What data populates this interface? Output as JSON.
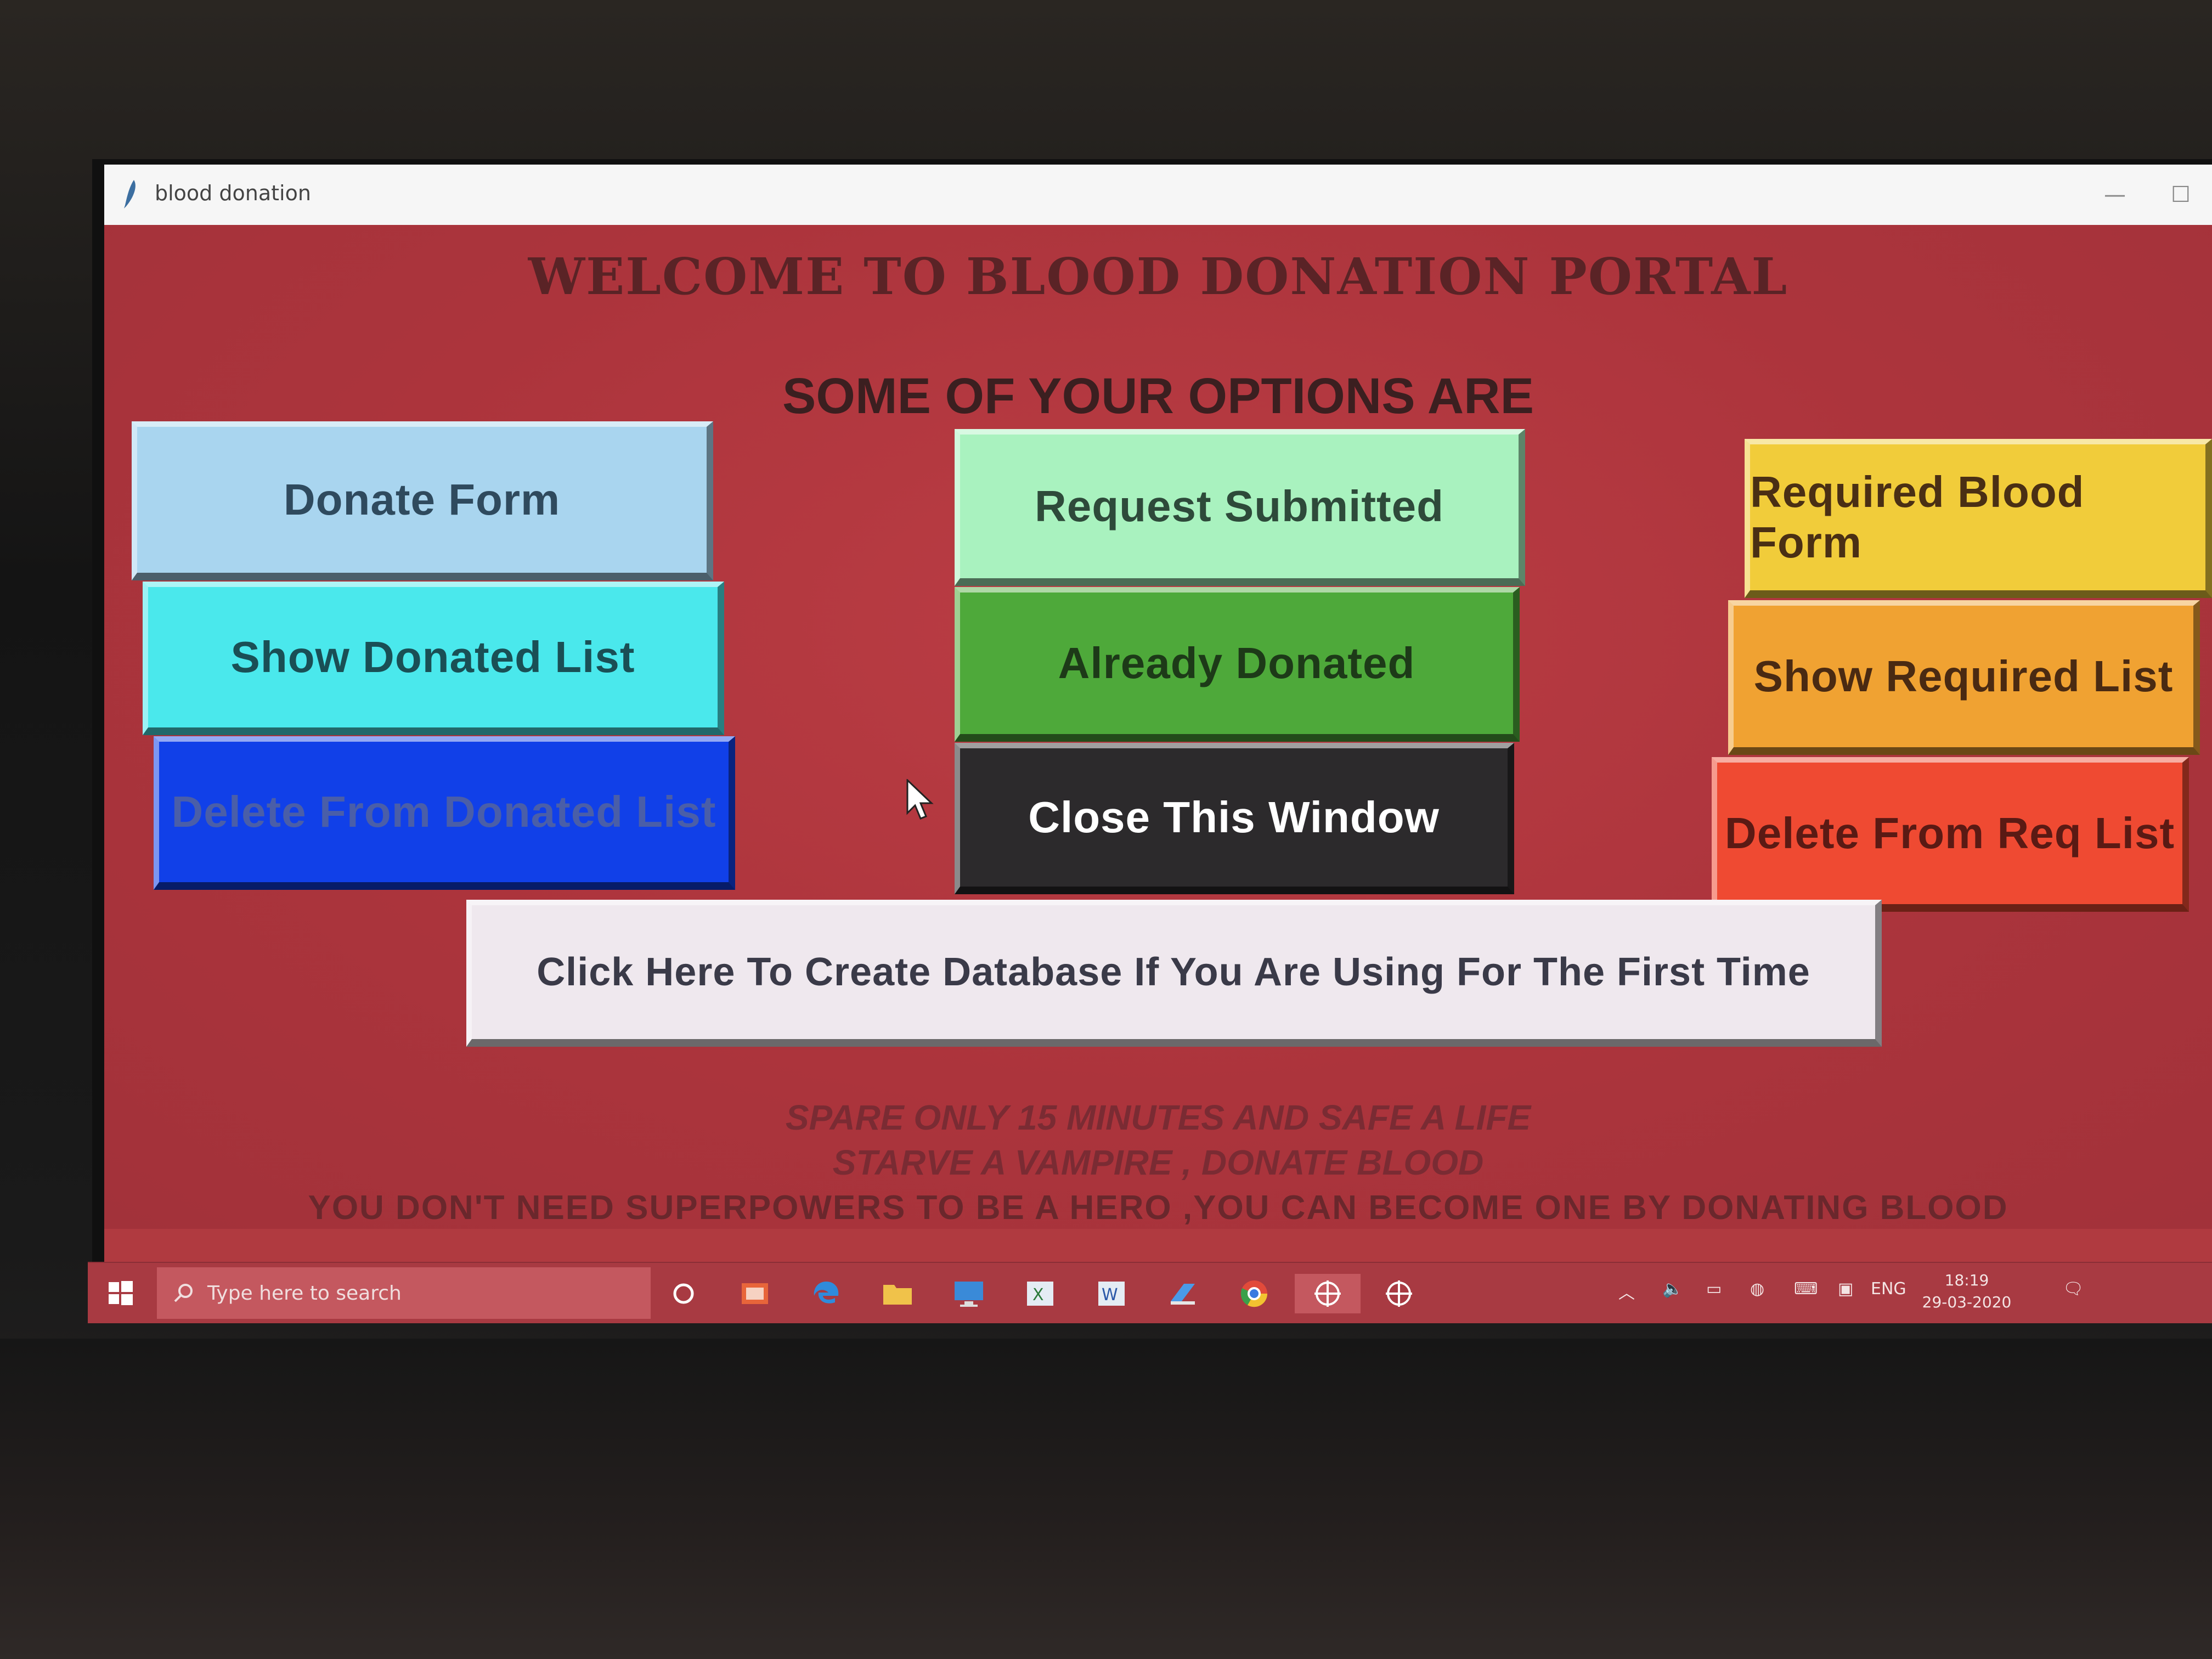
{
  "window": {
    "title": "blood donation",
    "minimize_glyph": "—",
    "maximize_glyph": "☐"
  },
  "header": {
    "welcome": "WELCOME TO BLOOD DONATION PORTAL",
    "subtitle": "SOME OF YOUR OPTIONS ARE"
  },
  "buttons": {
    "donate_form": "Donate Form",
    "show_donated_list": "Show Donated List",
    "delete_from_donated_list": "Delete From Donated List",
    "request_submitted": "Request Submitted",
    "already_donated": "Already Donated",
    "close_window": "Close This Window",
    "required_blood_form": "Required Blood Form",
    "show_required_list": "Show Required List",
    "delete_from_req_list": "Delete From Req List",
    "create_database": "Click Here To Create Database If You Are Using For The First Time"
  },
  "quotes": {
    "line1": "SPARE ONLY 15 MINUTES AND SAFE A LIFE",
    "line2": "STARVE A VAMPIRE , DONATE BLOOD",
    "line3": "YOU DON'T NEED SUPERPOWERS TO BE A HERO ,YOU CAN BECOME ONE BY DONATING BLOOD"
  },
  "taskbar": {
    "search_placeholder": "Type here to search",
    "language": "ENG",
    "time": "18:19",
    "date": "29-03-2020",
    "icons": [
      "windows-start-icon",
      "cortana-icon",
      "office-icon",
      "edge-icon",
      "file-explorer-icon",
      "computer-icon",
      "excel-icon",
      "word-icon",
      "app-icon",
      "chrome-icon",
      "python-tk-icon",
      "python-tk-icon"
    ]
  },
  "colors": {
    "background": "#b03a40",
    "donate_form": "#a9d5ef",
    "show_donated_list": "#4ae8ec",
    "delete_from_donated_list": "#1140e8",
    "request_submitted": "#a9f2bf",
    "already_donated": "#4ea93a",
    "close_window": "#2c2a2c",
    "required_blood_form": "#f1cc3a",
    "show_required_list": "#f0a232",
    "delete_from_req_list": "#ef4a32",
    "create_database": "#efe8ee"
  }
}
